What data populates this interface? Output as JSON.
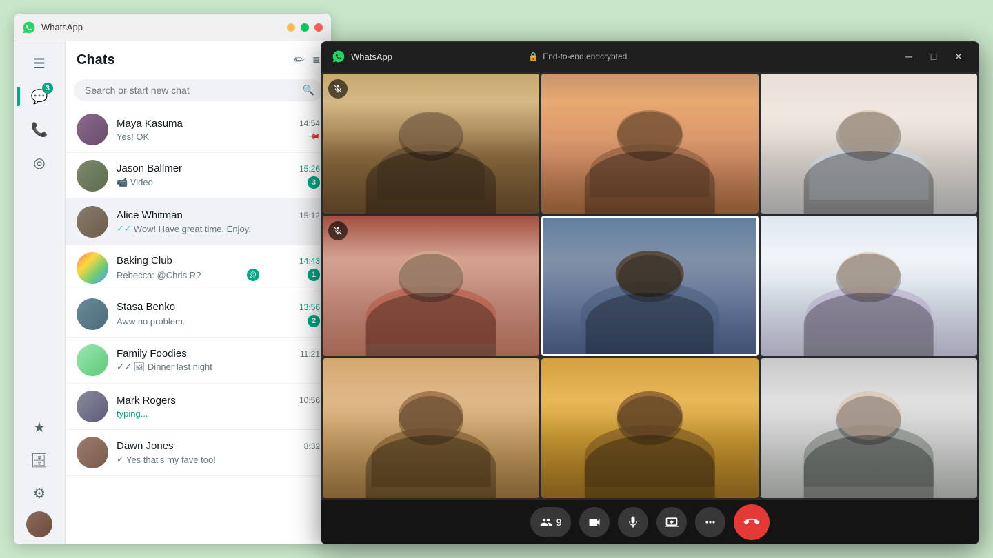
{
  "app": {
    "title": "WhatsApp",
    "titlebar_controls": {
      "minimize": "─",
      "maximize": "□",
      "close": "✕"
    }
  },
  "sidebar": {
    "icons": [
      {
        "name": "menu-icon",
        "symbol": "☰",
        "active": false
      },
      {
        "name": "chats-icon",
        "symbol": "💬",
        "active": true,
        "badge": "3"
      },
      {
        "name": "calls-icon",
        "symbol": "📞",
        "active": false
      },
      {
        "name": "status-icon",
        "symbol": "◎",
        "active": false
      },
      {
        "name": "starred-icon",
        "symbol": "★",
        "active": false
      },
      {
        "name": "archived-icon",
        "symbol": "🗄",
        "active": false
      }
    ],
    "bottom": {
      "settings_icon": "⚙",
      "avatar_label": "My profile"
    }
  },
  "chat_panel": {
    "title": "Chats",
    "new_chat_icon": "✏",
    "filter_icon": "≡",
    "search_placeholder": "Search or start new chat",
    "chats": [
      {
        "id": "maya",
        "name": "Maya Kasuma",
        "preview": "Yes! OK",
        "time": "14:54",
        "unread": 0,
        "pinned": true,
        "has_check": false,
        "avatar_class": "avatar-maya"
      },
      {
        "id": "jason",
        "name": "Jason Ballmer",
        "preview": "Video",
        "time": "15:26",
        "unread": 3,
        "pinned": false,
        "has_video_icon": true,
        "time_unread": true,
        "avatar_class": "avatar-jason"
      },
      {
        "id": "alice",
        "name": "Alice Whitman",
        "preview": "Wow! Have great time. Enjoy.",
        "time": "15:12",
        "unread": 0,
        "pinned": false,
        "active": true,
        "has_check": true,
        "double_check": true,
        "avatar_class": "avatar-alice"
      },
      {
        "id": "baking",
        "name": "Baking Club",
        "preview": "Rebecca: @Chris R?",
        "time": "14:43",
        "unread": 1,
        "mention": true,
        "time_unread": true,
        "avatar_class": "avatar-baking"
      },
      {
        "id": "stasa",
        "name": "Stasa Benko",
        "preview": "Aww no problem.",
        "time": "13:56",
        "unread": 2,
        "time_unread": true,
        "avatar_class": "avatar-stasa"
      },
      {
        "id": "family",
        "name": "Family Foodies",
        "preview": "Dinner last night",
        "time": "11:21",
        "unread": 0,
        "has_check": true,
        "double_check": true,
        "has_image_icon": true,
        "avatar_class": "avatar-family"
      },
      {
        "id": "mark",
        "name": "Mark Rogers",
        "preview": "typing...",
        "time": "10:56",
        "unread": 0,
        "typing": true,
        "avatar_class": "avatar-mark"
      },
      {
        "id": "dawn",
        "name": "Dawn Jones",
        "preview": "Yes that's my fave too!",
        "time": "8:32",
        "unread": 0,
        "has_check": true,
        "avatar_class": "avatar-dawn"
      }
    ]
  },
  "video_call": {
    "app_title": "WhatsApp",
    "encryption_label": "End-to-end endcrypted",
    "lock_icon": "🔒",
    "participants_count": "9",
    "controls": {
      "participants_label": "9",
      "video_icon": "📹",
      "mic_icon": "🎤",
      "share_icon": "⬆",
      "more_icon": "•••",
      "end_call_icon": "📞"
    },
    "grid_cells": [
      {
        "id": 1,
        "muted": true,
        "bg": "bg-kitchen",
        "highlighted": false
      },
      {
        "id": 2,
        "muted": false,
        "bg": "bg-smiling",
        "highlighted": false
      },
      {
        "id": 3,
        "muted": false,
        "bg": "bg-office-light",
        "highlighted": false
      },
      {
        "id": 4,
        "muted": true,
        "bg": "bg-red-sweater",
        "highlighted": false
      },
      {
        "id": 5,
        "muted": false,
        "bg": "bg-blue-shirt",
        "highlighted": true
      },
      {
        "id": 6,
        "muted": false,
        "bg": "bg-light-room",
        "highlighted": false
      },
      {
        "id": 7,
        "muted": false,
        "bg": "bg-curly",
        "highlighted": false
      },
      {
        "id": 8,
        "muted": false,
        "bg": "bg-warm-light",
        "highlighted": false
      },
      {
        "id": 9,
        "muted": false,
        "bg": "bg-plaid",
        "highlighted": false
      }
    ]
  }
}
